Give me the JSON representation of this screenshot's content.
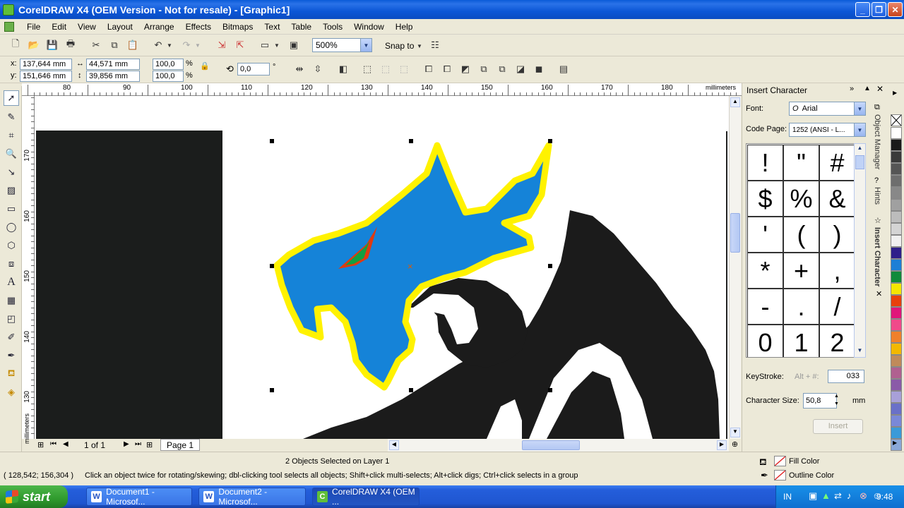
{
  "window": {
    "title": "CorelDRAW X4 (OEM Version - Not for resale) - [Graphic1]"
  },
  "menu": [
    "File",
    "Edit",
    "View",
    "Layout",
    "Arrange",
    "Effects",
    "Bitmaps",
    "Text",
    "Table",
    "Tools",
    "Window",
    "Help"
  ],
  "toolbar": {
    "zoom": "500%",
    "snap_to": "Snap to"
  },
  "propbar": {
    "x_label": "x:",
    "x_value": "137,644 mm",
    "y_label": "y:",
    "y_value": "151,646 mm",
    "w_value": "44,571 mm",
    "h_value": "39,856 mm",
    "sx_value": "100,0",
    "sy_value": "100,0",
    "pct": "%",
    "rotation": "0,0",
    "deg": "°"
  },
  "ruler": {
    "h_labels": [
      "80",
      "90",
      "100",
      "110",
      "120",
      "130",
      "140",
      "150",
      "160",
      "170",
      "180"
    ],
    "h_unit": "millimeters",
    "v_labels": [
      "170",
      "160",
      "150",
      "140",
      "130"
    ],
    "v_unit": "millimeters"
  },
  "pagebar": {
    "count": "1 of 1",
    "tab": "Page 1"
  },
  "docker": {
    "title": "Insert Character",
    "font_label": "Font:",
    "font_value": "Arial",
    "codepage_label": "Code Page:",
    "codepage_value": "1252  (ANSI - L...",
    "chars": [
      "!",
      "\"",
      "#",
      "$",
      "%",
      "&",
      "'",
      "(",
      ")",
      "*",
      "+",
      ",",
      "-",
      ".",
      "/",
      "0",
      "1",
      "2"
    ],
    "keystroke_label": "KeyStroke:",
    "keystroke_hint": "Alt + #:",
    "keystroke_value": "033",
    "charsize_label": "Character Size:",
    "charsize_value": "50,8",
    "charsize_unit": "mm",
    "insert_label": "Insert"
  },
  "side_tabs": [
    "Object Manager",
    "Hints",
    "Insert Character"
  ],
  "palette": [
    "#ffffff",
    "#1a1a1a",
    "#3a3a3a",
    "#555555",
    "#6e6e6e",
    "#888888",
    "#a0a0a0",
    "#bcbcbc",
    "#d4d4d4",
    "#f0f0f0",
    "#2e1f8a",
    "#1d7fd6",
    "#108a3a",
    "#f5e600",
    "#e8400c",
    "#e0167a",
    "#f04a8a",
    "#f0802a",
    "#f2b800",
    "#c08a5a",
    "#b06090",
    "#8a5aa8",
    "#a8a0d8",
    "#6a70c8",
    "#7a88d8",
    "#3a9ad8",
    "#8aa8d8"
  ],
  "status": {
    "selected": "2 Objects Selected on Layer 1",
    "coords": "( 128,542; 156,304 )",
    "hint": "Click an object twice for rotating/skewing; dbl-clicking tool selects all objects; Shift+click multi-selects; Alt+click digs; Ctrl+click selects in a group",
    "fill_label": "Fill Color",
    "outline_label": "Outline Color"
  },
  "taskbar": {
    "start": "start",
    "tasks": [
      "Document1 - Microsof...",
      "Document2 - Microsof...",
      "CorelDRAW X4 (OEM ..."
    ],
    "lang": "IN",
    "clock": "9:48"
  }
}
